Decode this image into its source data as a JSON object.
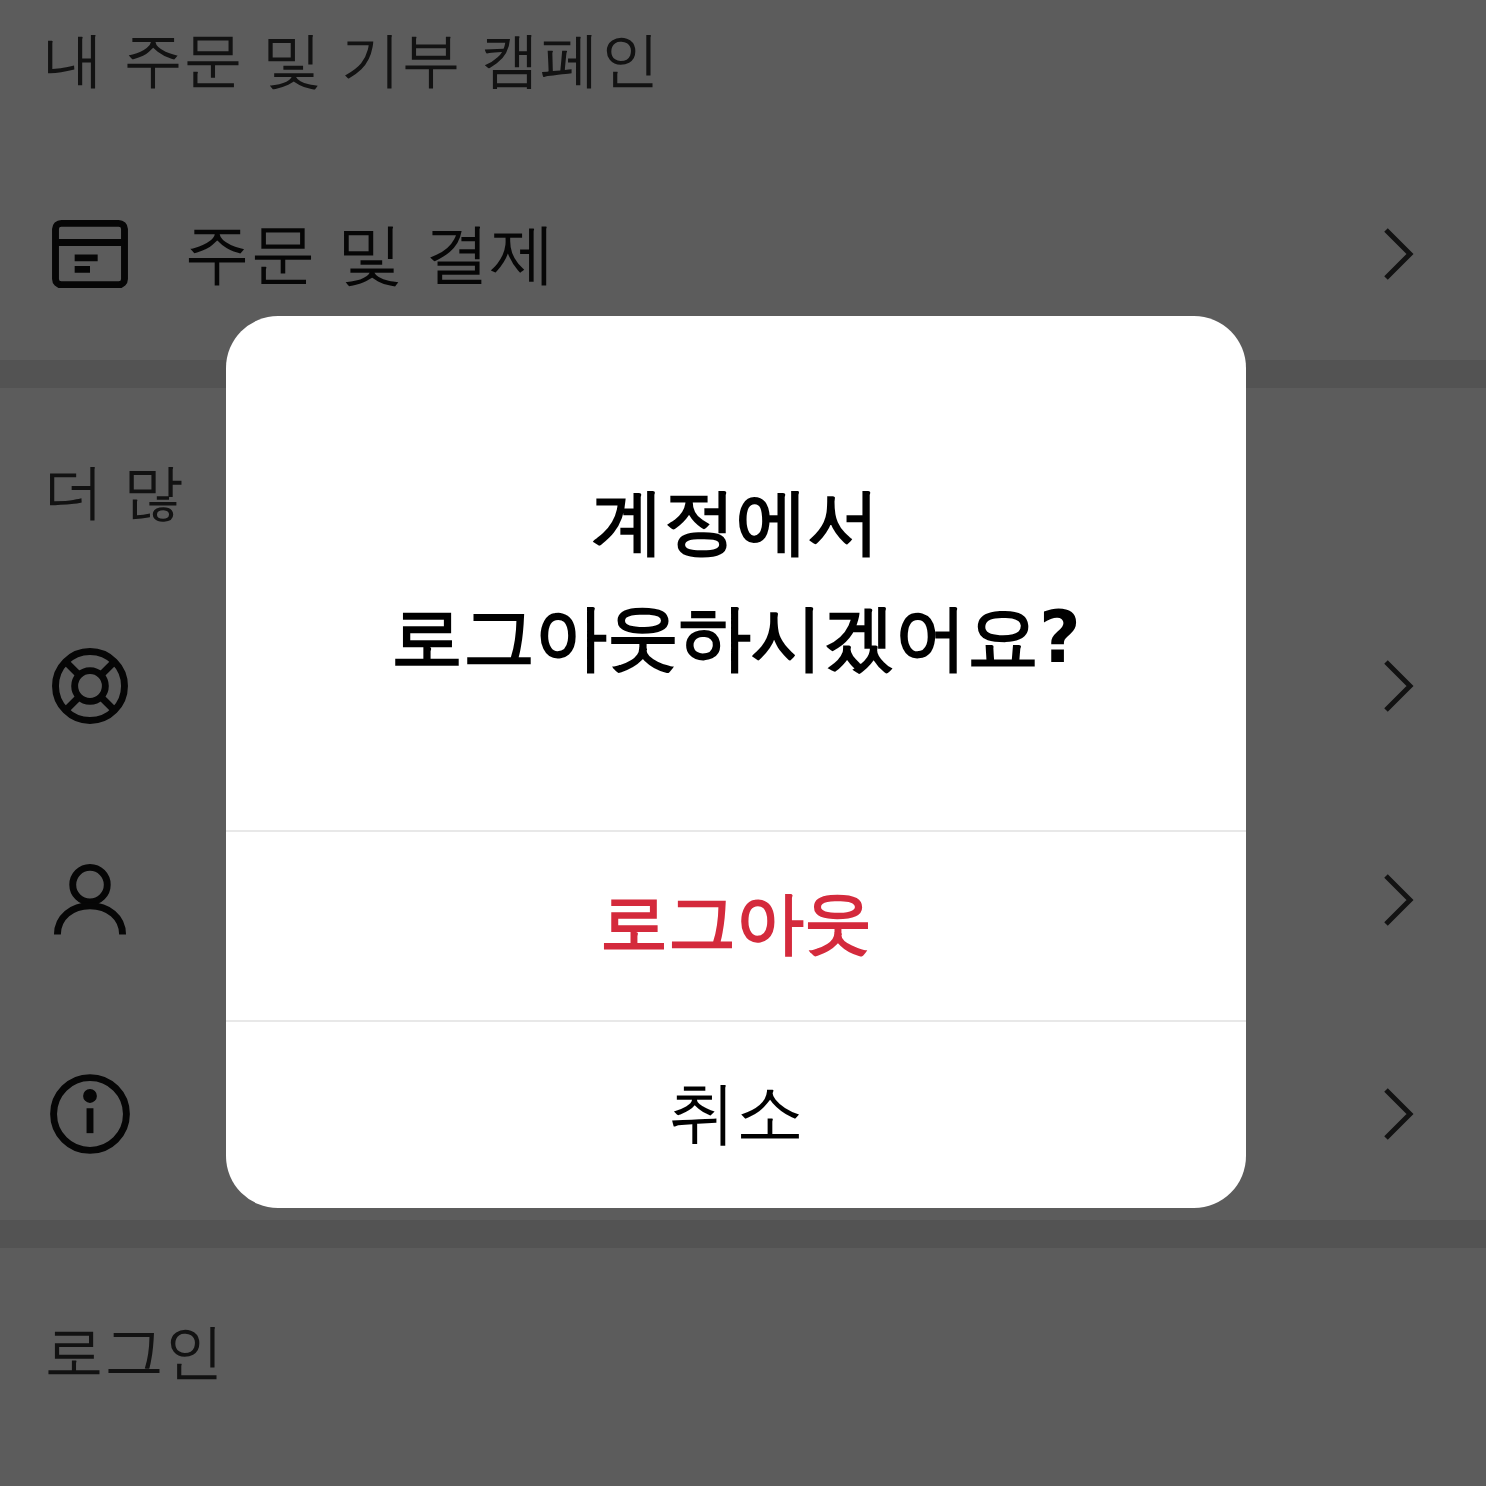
{
  "sections": [
    {
      "header": "내 주문 및 기부 캠페인",
      "rows": [
        {
          "kind": "box",
          "label": "주문 및 결제"
        }
      ]
    },
    {
      "header": "더 많",
      "rows": [
        {
          "kind": "lifebuoy"
        },
        {
          "kind": "user"
        },
        {
          "kind": "info"
        }
      ]
    },
    {
      "header": "로그인"
    }
  ],
  "dialog": {
    "title_lines": [
      "계정에서",
      "로그아웃하시겠어요?"
    ],
    "actions": [
      {
        "label": "로그아웃",
        "kind": "destructive"
      },
      {
        "label": "취소",
        "kind": "normal"
      }
    ]
  }
}
